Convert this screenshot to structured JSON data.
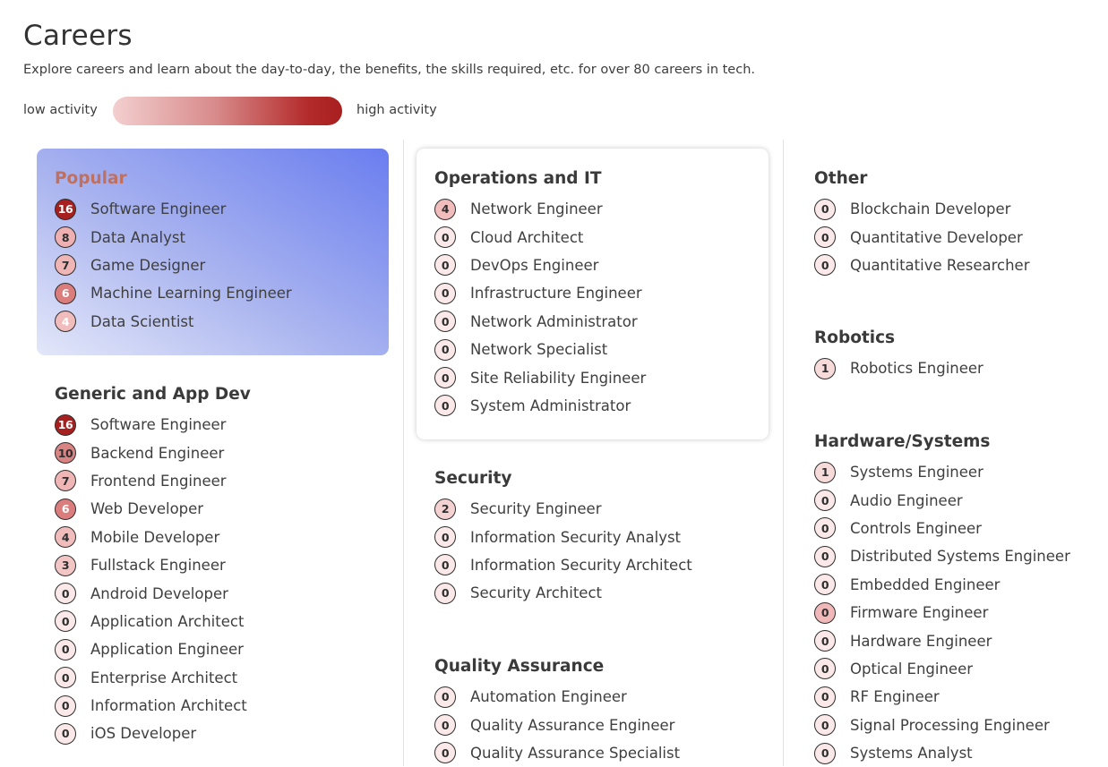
{
  "header": {
    "title": "Careers",
    "subtitle": "Explore careers and learn about the day-to-day, the benefits, the skills required, etc. for over 80 careers in tech.",
    "legend_low": "low activity",
    "legend_high": "high activity"
  },
  "colors": {
    "badge_level_16": "#a81f1f",
    "badge_level_10": "#d98383",
    "badge_level_8": "#eeb0b0",
    "badge_level_7": "#f0b6b6",
    "badge_level_6": "#dc7d7d",
    "badge_level_4": "#f1bcbc",
    "badge_level_3": "#f3c6c6",
    "badge_level_2": "#f5d2d2",
    "badge_level_1": "#f7dada",
    "badge_level_0": "#fbe8e8",
    "badge_firmware": "#f0b8b8",
    "popular_card": "#6a7def",
    "popular_title": "#c0705e"
  },
  "sections": {
    "popular": {
      "title": "Popular",
      "items": [
        {
          "count": "16",
          "label": "Software Engineer"
        },
        {
          "count": "8",
          "label": "Data Analyst"
        },
        {
          "count": "7",
          "label": "Game Designer"
        },
        {
          "count": "6",
          "label": "Machine Learning Engineer"
        },
        {
          "count": "4",
          "label": "Data Scientist"
        }
      ]
    },
    "generic": {
      "title": "Generic and App Dev",
      "items": [
        {
          "count": "16",
          "label": "Software Engineer"
        },
        {
          "count": "10",
          "label": "Backend Engineer"
        },
        {
          "count": "7",
          "label": "Frontend Engineer"
        },
        {
          "count": "6",
          "label": "Web Developer"
        },
        {
          "count": "4",
          "label": "Mobile Developer"
        },
        {
          "count": "3",
          "label": "Fullstack Engineer"
        },
        {
          "count": "0",
          "label": "Android Developer"
        },
        {
          "count": "0",
          "label": "Application Architect"
        },
        {
          "count": "0",
          "label": "Application Engineer"
        },
        {
          "count": "0",
          "label": "Enterprise Architect"
        },
        {
          "count": "0",
          "label": "Information Architect"
        },
        {
          "count": "0",
          "label": "iOS Developer"
        }
      ]
    },
    "ops": {
      "title": "Operations and IT",
      "items": [
        {
          "count": "4",
          "label": "Network Engineer"
        },
        {
          "count": "0",
          "label": "Cloud Architect"
        },
        {
          "count": "0",
          "label": "DevOps Engineer"
        },
        {
          "count": "0",
          "label": "Infrastructure Engineer"
        },
        {
          "count": "0",
          "label": "Network Administrator"
        },
        {
          "count": "0",
          "label": "Network Specialist"
        },
        {
          "count": "0",
          "label": "Site Reliability Engineer"
        },
        {
          "count": "0",
          "label": "System Administrator"
        }
      ]
    },
    "security": {
      "title": "Security",
      "items": [
        {
          "count": "2",
          "label": "Security Engineer"
        },
        {
          "count": "0",
          "label": "Information Security Analyst"
        },
        {
          "count": "0",
          "label": "Information Security Architect"
        },
        {
          "count": "0",
          "label": "Security Architect"
        }
      ]
    },
    "qa": {
      "title": "Quality Assurance",
      "items": [
        {
          "count": "0",
          "label": "Automation Engineer"
        },
        {
          "count": "0",
          "label": "Quality Assurance Engineer"
        },
        {
          "count": "0",
          "label": "Quality Assurance Specialist"
        }
      ]
    },
    "other": {
      "title": "Other",
      "items": [
        {
          "count": "0",
          "label": "Blockchain Developer"
        },
        {
          "count": "0",
          "label": "Quantitative Developer"
        },
        {
          "count": "0",
          "label": "Quantitative Researcher"
        }
      ]
    },
    "robotics": {
      "title": "Robotics",
      "items": [
        {
          "count": "1",
          "label": "Robotics Engineer"
        }
      ]
    },
    "hardware": {
      "title": "Hardware/Systems",
      "items": [
        {
          "count": "1",
          "label": "Systems Engineer"
        },
        {
          "count": "0",
          "label": "Audio Engineer"
        },
        {
          "count": "0",
          "label": "Controls Engineer"
        },
        {
          "count": "0",
          "label": "Distributed Systems Engineer"
        },
        {
          "count": "0",
          "label": "Embedded Engineer"
        },
        {
          "count": "0",
          "label": "Firmware Engineer"
        },
        {
          "count": "0",
          "label": "Hardware Engineer"
        },
        {
          "count": "0",
          "label": "Optical Engineer"
        },
        {
          "count": "0",
          "label": "RF Engineer"
        },
        {
          "count": "0",
          "label": "Signal Processing Engineer"
        },
        {
          "count": "0",
          "label": "Systems Analyst"
        }
      ]
    }
  }
}
